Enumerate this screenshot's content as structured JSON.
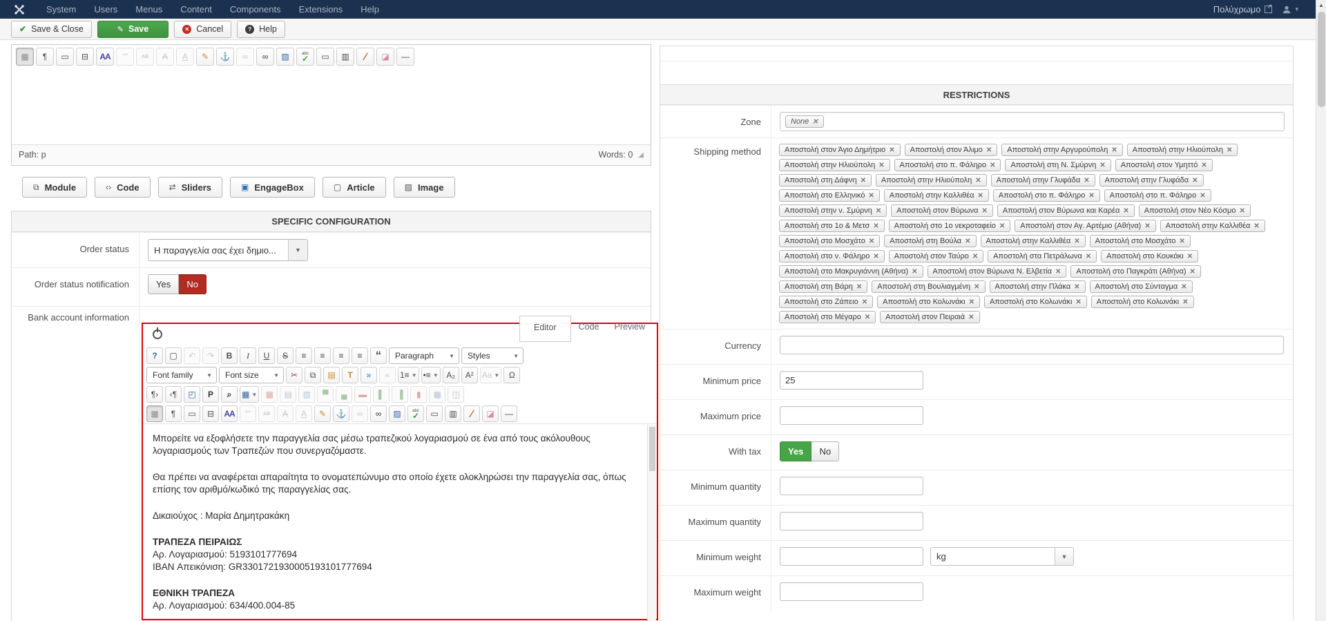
{
  "topbar": {
    "menus": [
      "System",
      "Users",
      "Menus",
      "Content",
      "Components",
      "Extensions",
      "Help"
    ],
    "site_name": "Πολύχρωμο"
  },
  "toolbar": {
    "save_close_label": "Save & Close",
    "save_label": "Save",
    "cancel_label": "Cancel",
    "help_label": "Help"
  },
  "editor_top": {
    "toolbar_icons": [
      "visual-aid*",
      "show-blocks",
      "pagebreak",
      "readmore",
      "fonts",
      "quotes!",
      "abbr!",
      "del!",
      "ins!",
      "note",
      "anchor",
      "unlink!",
      "link",
      "image",
      "spellcheck",
      "hr-box",
      "layout",
      "clean",
      "eraser",
      "hr"
    ],
    "path_label": "Path: p",
    "words_label": "Words: 0"
  },
  "insert_buttons": [
    {
      "label": "Module",
      "icon": "module-icon"
    },
    {
      "label": "Code",
      "icon": "code-icon"
    },
    {
      "label": "Sliders",
      "icon": "sliders-icon"
    },
    {
      "label": "EngageBox",
      "icon": "engagebox-icon"
    },
    {
      "label": "Article",
      "icon": "article-icon"
    },
    {
      "label": "Image",
      "icon": "image-icon"
    }
  ],
  "specific_configuration": {
    "title": "SPECIFIC CONFIGURATION",
    "order_status": {
      "label": "Order status",
      "value": "Η παραγγελία σας έχει δημιο..."
    },
    "order_status_notification": {
      "label": "Order status notification",
      "options": [
        "Yes",
        "No"
      ],
      "selected": "No"
    },
    "bank_account_information": {
      "label": "Bank account information"
    }
  },
  "bank_editor": {
    "tabs": [
      {
        "label": "Editor",
        "active": true
      },
      {
        "label": "Code",
        "active": false
      },
      {
        "label": "Preview",
        "active": false
      }
    ],
    "toolbar_rows": [
      [
        "help",
        "new-document",
        "undo!",
        "redo!",
        "bold",
        "italic",
        "underline",
        "strikethrough",
        "align-left",
        "align-center",
        "align-right",
        "align-justify",
        "blockquote",
        "sel:Paragraph",
        "sel:Styles"
      ],
      [
        "sel:Font family",
        "sel:Font size",
        "cut",
        "copy",
        "paste",
        "paste-text",
        "indent",
        "outdent!",
        "ordered-list^",
        "bullet-list^",
        "subscript",
        "superscript",
        "case!^",
        "omega"
      ],
      [
        "ltr",
        "rtl",
        "fullscreen",
        "print",
        "find",
        "table^",
        "delete-table!",
        "row-props!",
        "cell-props!",
        "row-above!",
        "row-below!",
        "delete-row!",
        "col-before!",
        "col-after!",
        "delete-col!",
        "merge-cells!",
        "split-cells!"
      ],
      [
        "visual-aid*",
        "show-blocks",
        "pagebreak",
        "readmore",
        "fonts",
        "quotes!",
        "abbr!",
        "del!",
        "ins!",
        "note",
        "anchor",
        "unlink!",
        "link",
        "image",
        "spellcheck",
        "hr-box",
        "layout",
        "clean",
        "eraser",
        "hr"
      ]
    ],
    "content_blocks": [
      {
        "lines": [
          {
            "text": "Μπορείτε να εξοφλήσετε την παραγγελία σας μέσω τραπεζικού λογαριασμού σε ένα από τους ακόλουθους λογαριασμούς των Τραπεζών που συνεργαζόμαστε.",
            "bold": false
          }
        ]
      },
      {
        "lines": [
          {
            "text": "Θα πρέπει να αναφέρεται απαραίτητα το ονοματεπώνυμο στο οποίο έχετε ολοκληρώσει την παραγγελία σας, όπως επίσης τον αριθμό/κωδικό της παραγγελίας σας.",
            "bold": false
          }
        ]
      },
      {
        "lines": [
          {
            "text": "Δικαιούχος : Μαρία Δημητρακάκη",
            "bold": false
          }
        ]
      },
      {
        "lines": [
          {
            "text": "ΤΡΑΠΕΖΑ ΠΕΙΡΑΙΩΣ",
            "bold": true
          },
          {
            "text": "Αρ. Λογαριασμού:  5193101777694",
            "bold": false
          },
          {
            "text": "IBAN Απεικόνιση: GR3301721930005193101777694",
            "bold": false
          }
        ]
      },
      {
        "lines": [
          {
            "text": "ΕΘΝΙΚΗ ΤΡΑΠΕΖΑ",
            "bold": true
          },
          {
            "text": "Αρ. Λογαριασμού: 634/400.004-85",
            "bold": false
          }
        ]
      }
    ]
  },
  "restrictions": {
    "title": "RESTRICTIONS",
    "zone": {
      "label": "Zone",
      "tags": [
        "None"
      ]
    },
    "shipping_method": {
      "label": "Shipping method",
      "tags": [
        "Αποστολή στον Άγιο Δημήτριο",
        "Αποστολή στον Άλιμο",
        "Αποστολή στην Αργυρούπολη",
        "Αποστολή στην Ηλιούπολη",
        "Αποστολή στην Ηλιούπολη",
        "Αποστολή στο π. Φάληρο",
        "Αποστολή στη Ν. Σμύρνη",
        "Αποστολή στον Υμηττό",
        "Αποστολή στη Δάφνη",
        "Αποστολή στην Ηλιούπολη",
        "Αποστολή στην Γλυφάδα",
        "Αποστολή στην Γλυφάδα",
        "Αποστολή στο Ελληνικό",
        "Αποστολή στην Καλλιθέα",
        "Αποστολή στο π. Φάληρο",
        "Αποστολή στο π. Φάληρο",
        "Αποστολή στην ν. Σμύρνη",
        "Αποστολή στον Βύρωνα",
        "Αποστολή στον Βύρωνα και Καρέα",
        "Αποστολή στον Νέο Κόσμο",
        "Αποστολή στο 1ο & Μετσ",
        "Αποστολή στο 1ο νεκροταφείο",
        "Αποστολή στον Αγ. Αρτέμιο (Αθήνα)",
        "Αποστολή στην Καλλιθέα",
        "Αποστολή στο Μοσχάτο",
        "Αποστολή στη Βούλα",
        "Αποστολή στην Καλλιθέα",
        "Αποστολή στο Μοσχάτο",
        "Αποστολή στο ν. Φάληρο",
        "Αποστολή στον Ταύρο",
        "Αποστολή στα Πετράλωνα",
        "Αποστολή στο Κουκάκι",
        "Αποστολή στο Μακρυγιάννη (Αθήνα)",
        "Αποστολή στον Βύρωνα Ν. Ελβετία",
        "Αποστολή στο Παγκράτι (Αθήνα)",
        "Αποστολή στη Βάρη",
        "Αποστολή στη Βουλιαγμένη",
        "Αποστολή στην Πλάκα",
        "Αποστολή στο Σύνταγμα",
        "Αποστολή στο Ζάπειο",
        "Αποστολή στο Κολωνάκι",
        "Αποστολή στο Κολωνάκι",
        "Αποστολή στο Κολωνάκι",
        "Αποστολή στο Μέγαρο",
        "Αποστολή στον Πειραιά"
      ]
    },
    "currency": {
      "label": "Currency",
      "value": ""
    },
    "minimum_price": {
      "label": "Minimum price",
      "value": "25"
    },
    "maximum_price": {
      "label": "Maximum price",
      "value": ""
    },
    "with_tax": {
      "label": "With tax",
      "options": [
        "Yes",
        "No"
      ],
      "selected": "Yes"
    },
    "minimum_quantity": {
      "label": "Minimum quantity",
      "value": ""
    },
    "maximum_quantity": {
      "label": "Maximum quantity",
      "value": ""
    },
    "minimum_weight": {
      "label": "Minimum weight",
      "value": "",
      "unit": "kg"
    },
    "maximum_weight": {
      "label": "Maximum weight",
      "value": ""
    }
  }
}
